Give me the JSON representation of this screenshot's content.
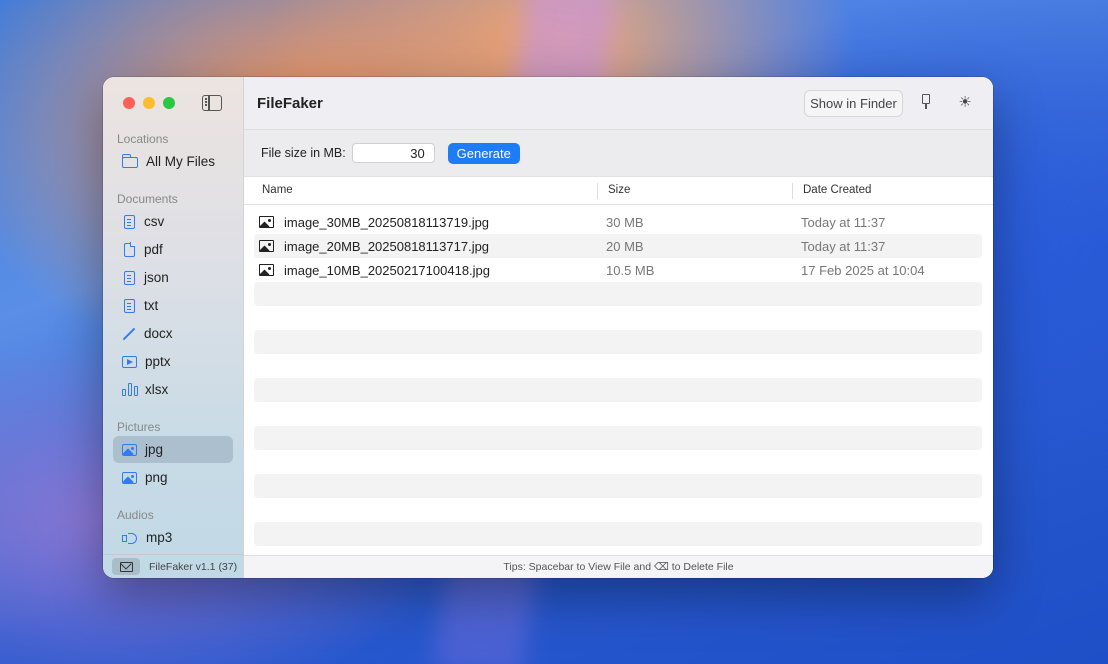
{
  "app": {
    "title": "FileFaker",
    "version": "FileFaker v1.1 (37)"
  },
  "header": {
    "show_in_finder": "Show in Finder"
  },
  "toolbar": {
    "size_label": "File size in MB:",
    "size_value": "30",
    "generate_label": "Generate"
  },
  "sidebar": {
    "sections": [
      {
        "title": "Locations",
        "items": [
          {
            "label": "All My Files",
            "icon": "folder-icon"
          }
        ]
      },
      {
        "title": "Documents",
        "items": [
          {
            "label": "csv",
            "icon": "document-icon"
          },
          {
            "label": "pdf",
            "icon": "pdf-icon"
          },
          {
            "label": "json",
            "icon": "document-icon"
          },
          {
            "label": "txt",
            "icon": "document-icon"
          },
          {
            "label": "docx",
            "icon": "pen-icon"
          },
          {
            "label": "pptx",
            "icon": "presentation-icon"
          },
          {
            "label": "xlsx",
            "icon": "chart-bars-icon"
          }
        ]
      },
      {
        "title": "Pictures",
        "items": [
          {
            "label": "jpg",
            "icon": "photo-icon",
            "selected": true
          },
          {
            "label": "png",
            "icon": "photo-icon"
          }
        ]
      },
      {
        "title": "Audios",
        "items": [
          {
            "label": "mp3",
            "icon": "speaker-icon"
          }
        ]
      }
    ]
  },
  "table": {
    "columns": [
      "Name",
      "Size",
      "Date Created"
    ],
    "rows": [
      {
        "name": "image_30MB_20250818113719.jpg",
        "size": "30 MB",
        "date": "Today at 11:37"
      },
      {
        "name": "image_20MB_20250818113717.jpg",
        "size": "20 MB",
        "date": "Today at 11:37"
      },
      {
        "name": "image_10MB_20250217100418.jpg",
        "size": "10.5 MB",
        "date": "17 Feb 2025 at 10:04"
      }
    ]
  },
  "status": {
    "tip": "Tips: Spacebar to View File and ⌫ to Delete File"
  },
  "colors": {
    "accent": "#1f7cf7",
    "icon_blue": "#2f7cf6"
  }
}
